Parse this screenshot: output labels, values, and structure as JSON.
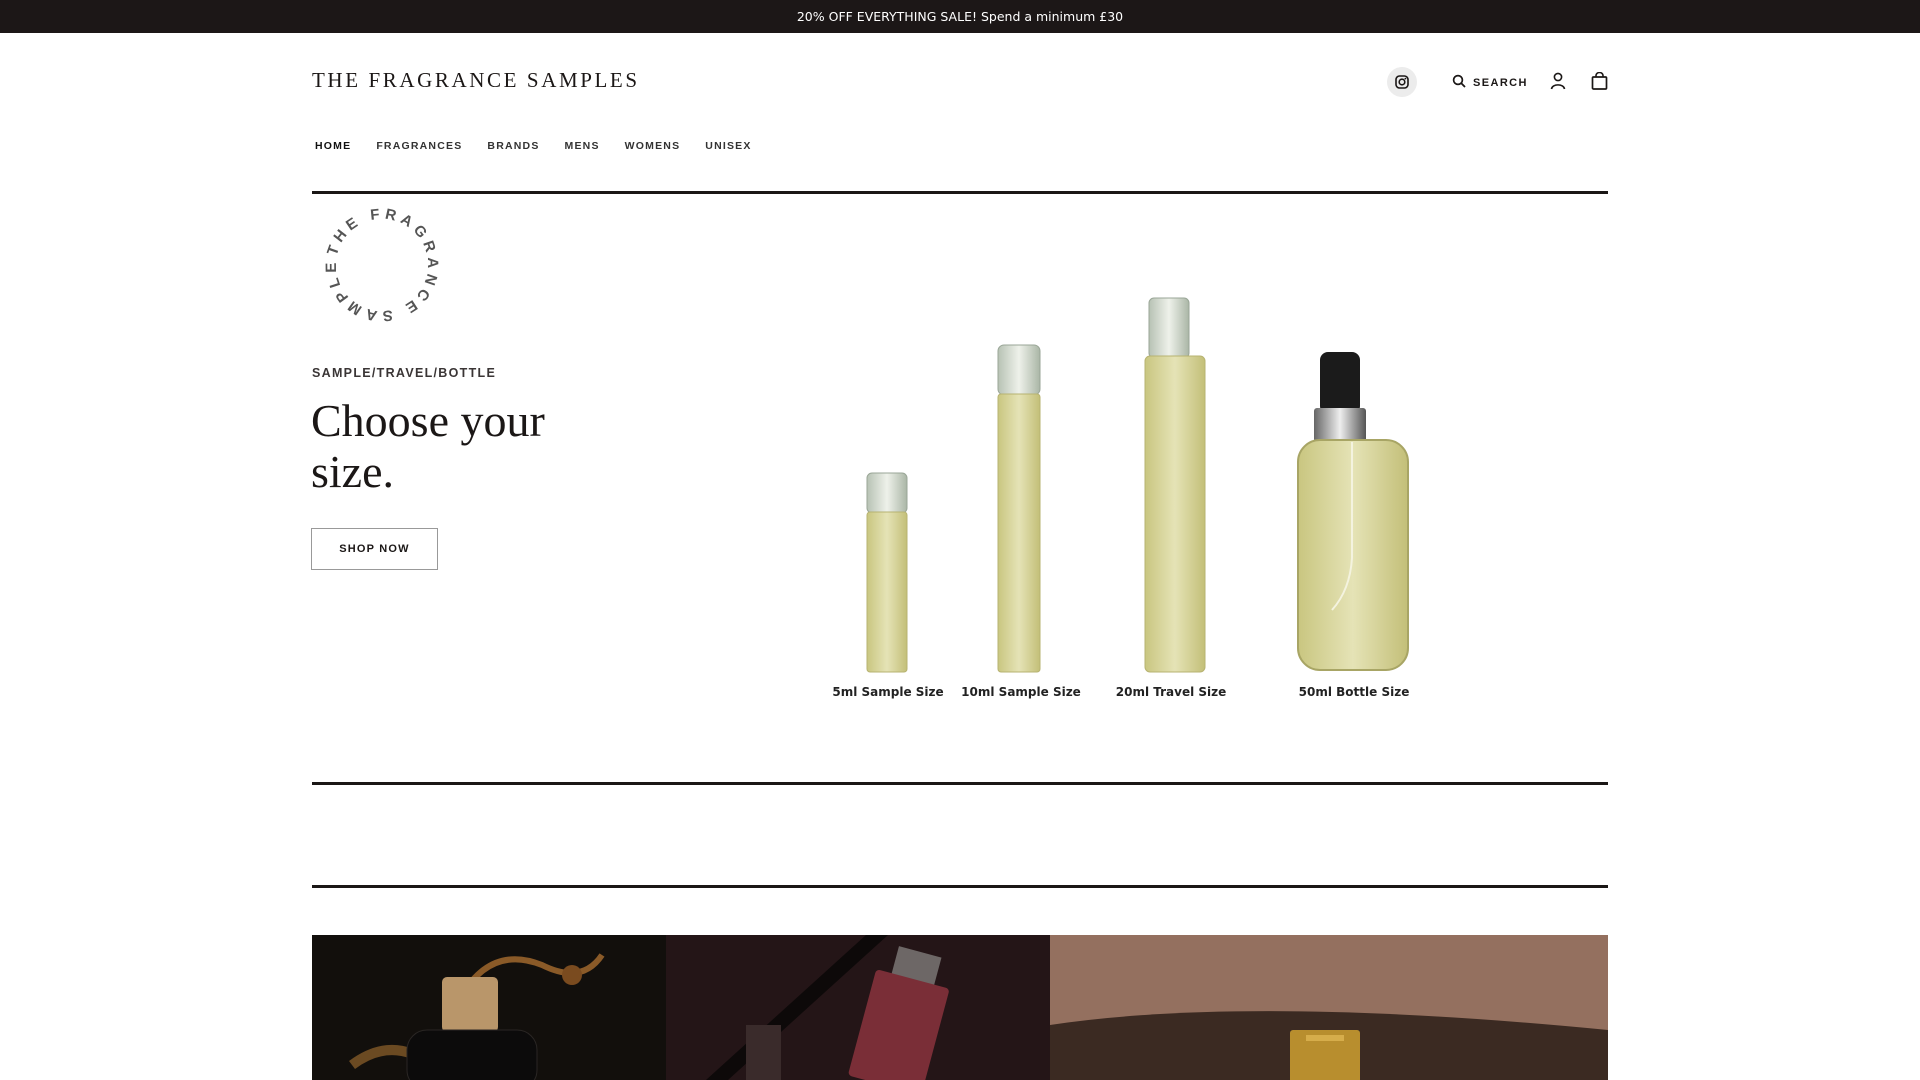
{
  "announcement": "20% OFF EVERYTHING SALE! Spend a minimum £30",
  "brand": {
    "logo_text": "THE FRAGRANCE SAMPLES",
    "badge_text": "THE FRAGRANCE SAMPLES"
  },
  "header": {
    "search_label": "SEARCH",
    "icons": [
      "instagram-icon",
      "search-icon",
      "account-icon",
      "cart-icon"
    ]
  },
  "nav": {
    "items": [
      {
        "label": "HOME"
      },
      {
        "label": "FRAGRANCES"
      },
      {
        "label": "BRANDS"
      },
      {
        "label": "MENS"
      },
      {
        "label": "WOMENS"
      },
      {
        "label": "UNISEX"
      }
    ]
  },
  "hero": {
    "eyebrow": "SAMPLE/TRAVEL/BOTTLE",
    "headline": "Choose your size.",
    "cta_label": "SHOP NOW",
    "sizes": [
      {
        "label": "5ml Sample Size"
      },
      {
        "label": "10ml Sample Size"
      },
      {
        "label": "20ml Travel Size"
      },
      {
        "label": "50ml Bottle Size"
      }
    ]
  },
  "colors": {
    "announcement_bg": "#1c1717",
    "text": "#1b1716",
    "liquid": "#d9d59a"
  }
}
